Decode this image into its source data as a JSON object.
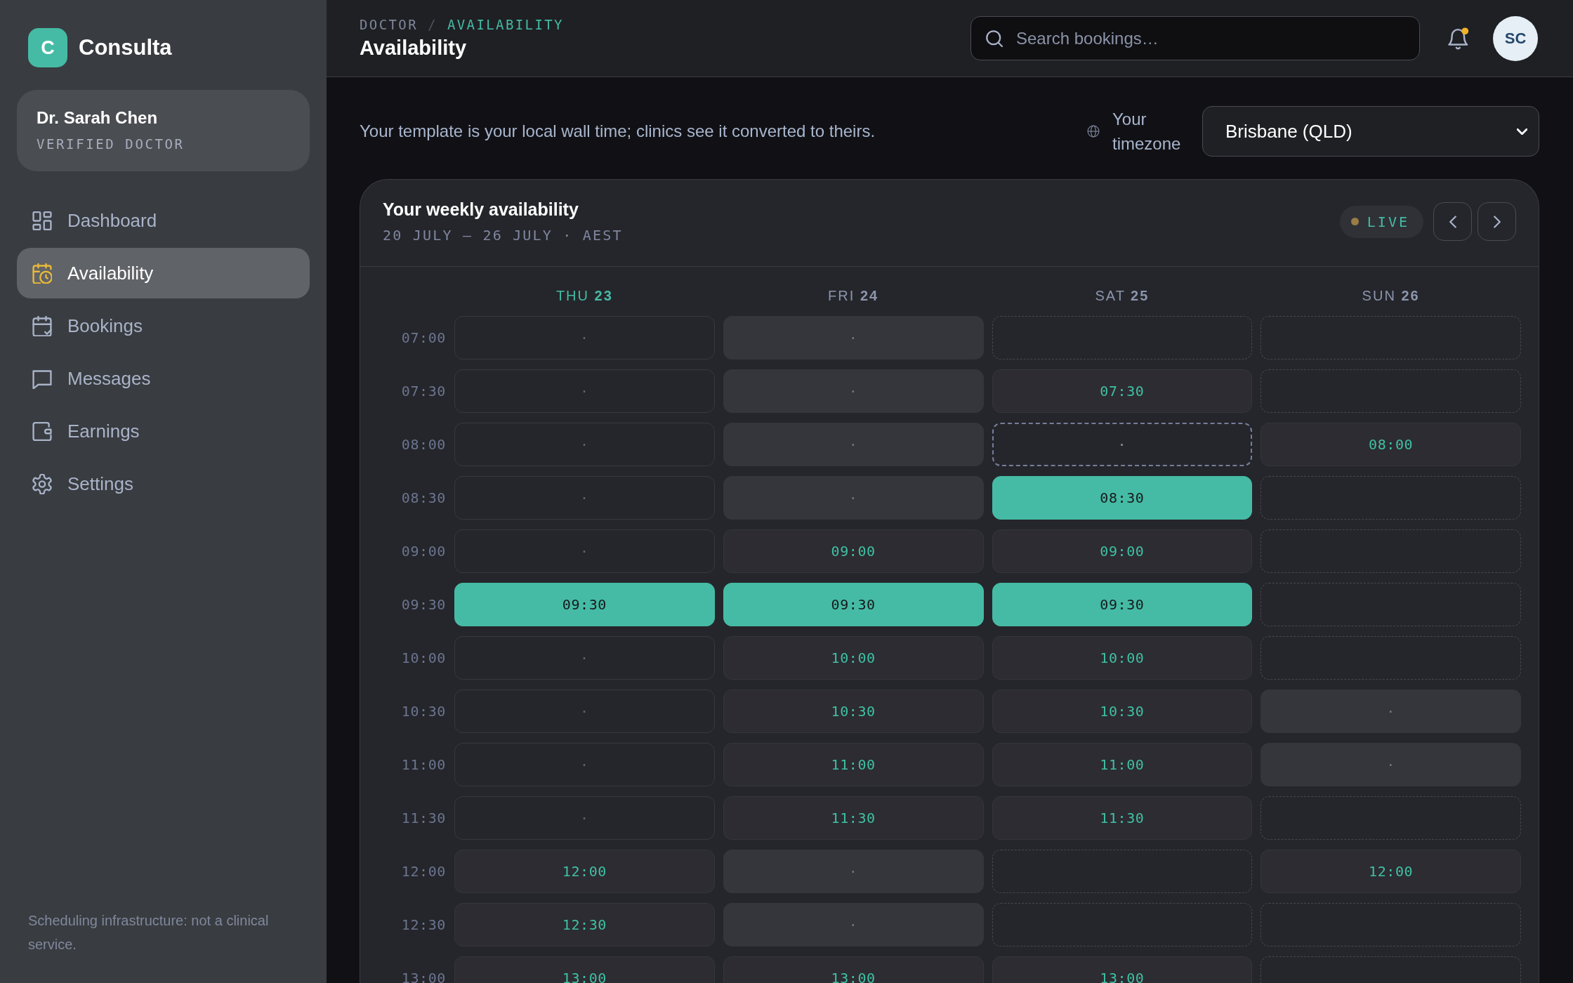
{
  "brand": {
    "initial": "C",
    "name": "Consulta"
  },
  "profile": {
    "name": "Dr. Sarah Chen",
    "role": "VERIFIED DOCTOR"
  },
  "sidebar": {
    "items": [
      {
        "label": "Dashboard",
        "selected": false
      },
      {
        "label": "Availability",
        "selected": true
      },
      {
        "label": "Bookings",
        "selected": false
      },
      {
        "label": "Messages",
        "selected": false
      },
      {
        "label": "Earnings",
        "selected": false
      },
      {
        "label": "Settings",
        "selected": false
      }
    ],
    "footer": "Scheduling infrastructure: not a clinical service."
  },
  "header": {
    "breadcrumb": {
      "items": [
        {
          "label": "DOCTOR",
          "current": false
        },
        {
          "label": "AVAILABILITY",
          "current": true
        }
      ],
      "separator": "/"
    },
    "title": "Availability",
    "search": {
      "placeholder": "Search bookings…"
    },
    "notifications": {
      "unread": true
    },
    "user": {
      "initials": "SC"
    }
  },
  "intro": {
    "note": "Your template is your local wall time; clinics see it converted to theirs.",
    "timezone": {
      "label": "Your timezone",
      "value": "Brisbane (QLD)"
    }
  },
  "schedule": {
    "title": "Your weekly availability",
    "range": "20 JULY – 26 JULY · AEST",
    "status": "LIVE",
    "days": [
      {
        "day": "THU",
        "date": "23",
        "today": true
      },
      {
        "day": "FRI",
        "date": "24",
        "today": false
      },
      {
        "day": "SAT",
        "date": "25",
        "today": false
      },
      {
        "day": "SUN",
        "date": "26",
        "today": false
      }
    ],
    "rows": [
      {
        "time": "07:00",
        "slots": [
          {
            "kind": "empty",
            "label": "·"
          },
          {
            "kind": "blocked",
            "label": "·"
          },
          {
            "kind": "off"
          },
          {
            "kind": "off"
          }
        ]
      },
      {
        "time": "07:30",
        "slots": [
          {
            "kind": "empty",
            "label": "·"
          },
          {
            "kind": "blocked",
            "label": "·"
          },
          {
            "kind": "open",
            "label": "07:30"
          },
          {
            "kind": "off"
          }
        ]
      },
      {
        "time": "08:00",
        "slots": [
          {
            "kind": "empty",
            "label": "·"
          },
          {
            "kind": "blocked",
            "label": "·"
          },
          {
            "kind": "pending",
            "label": "·"
          },
          {
            "kind": "open",
            "label": "08:00"
          }
        ]
      },
      {
        "time": "08:30",
        "slots": [
          {
            "kind": "empty",
            "label": "·"
          },
          {
            "kind": "blocked",
            "label": "·"
          },
          {
            "kind": "booked",
            "label": "08:30"
          },
          {
            "kind": "off"
          }
        ]
      },
      {
        "time": "09:00",
        "slots": [
          {
            "kind": "empty",
            "label": "·"
          },
          {
            "kind": "open",
            "label": "09:00"
          },
          {
            "kind": "open",
            "label": "09:00"
          },
          {
            "kind": "off"
          }
        ]
      },
      {
        "time": "09:30",
        "slots": [
          {
            "kind": "booked",
            "label": "09:30"
          },
          {
            "kind": "booked",
            "label": "09:30"
          },
          {
            "kind": "booked",
            "label": "09:30"
          },
          {
            "kind": "off"
          }
        ]
      },
      {
        "time": "10:00",
        "slots": [
          {
            "kind": "empty",
            "label": "·"
          },
          {
            "kind": "open",
            "label": "10:00"
          },
          {
            "kind": "open",
            "label": "10:00"
          },
          {
            "kind": "off"
          }
        ]
      },
      {
        "time": "10:30",
        "slots": [
          {
            "kind": "empty",
            "label": "·"
          },
          {
            "kind": "open",
            "label": "10:30"
          },
          {
            "kind": "open",
            "label": "10:30"
          },
          {
            "kind": "blocked",
            "label": "·"
          }
        ]
      },
      {
        "time": "11:00",
        "slots": [
          {
            "kind": "empty",
            "label": "·"
          },
          {
            "kind": "open",
            "label": "11:00"
          },
          {
            "kind": "open",
            "label": "11:00"
          },
          {
            "kind": "blocked",
            "label": "·"
          }
        ]
      },
      {
        "time": "11:30",
        "slots": [
          {
            "kind": "empty",
            "label": "·"
          },
          {
            "kind": "open",
            "label": "11:30"
          },
          {
            "kind": "open",
            "label": "11:30"
          },
          {
            "kind": "off"
          }
        ]
      },
      {
        "time": "12:00",
        "slots": [
          {
            "kind": "open",
            "label": "12:00"
          },
          {
            "kind": "blocked",
            "label": "·"
          },
          {
            "kind": "off"
          },
          {
            "kind": "open",
            "label": "12:00"
          }
        ]
      },
      {
        "time": "12:30",
        "slots": [
          {
            "kind": "open",
            "label": "12:30"
          },
          {
            "kind": "blocked",
            "label": "·"
          },
          {
            "kind": "off"
          },
          {
            "kind": "off"
          }
        ]
      },
      {
        "time": "13:00",
        "slots": [
          {
            "kind": "open",
            "label": "13:00"
          },
          {
            "kind": "open",
            "label": "13:00"
          },
          {
            "kind": "open",
            "label": "13:00"
          },
          {
            "kind": "off"
          }
        ]
      }
    ]
  }
}
